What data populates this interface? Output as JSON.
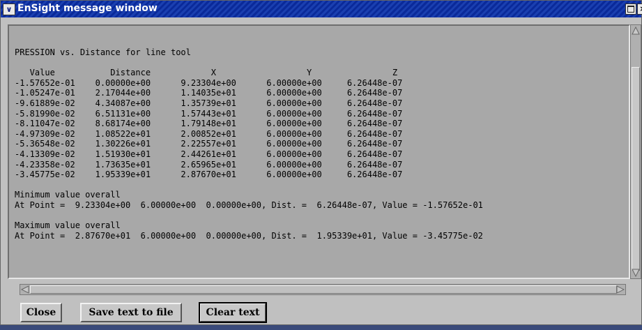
{
  "window": {
    "title": "EnSight message window",
    "menu_icon": "chevron-down-icon",
    "maximize_icon": "maximize-icon",
    "close_icon": "close-icon",
    "close_glyph": "×"
  },
  "message": {
    "heading": "PRESSION vs. Distance for line tool",
    "columns": [
      "Value",
      "Distance",
      "X",
      "Y",
      "Z"
    ],
    "rows": [
      [
        "-1.57652e-01",
        "0.00000e+00",
        "9.23304e+00",
        "6.00000e+00",
        "6.26448e-07"
      ],
      [
        "-1.05247e-01",
        "2.17044e+00",
        "1.14035e+01",
        "6.00000e+00",
        "6.26448e-07"
      ],
      [
        "-9.61889e-02",
        "4.34087e+00",
        "1.35739e+01",
        "6.00000e+00",
        "6.26448e-07"
      ],
      [
        "-5.81990e-02",
        "6.51131e+00",
        "1.57443e+01",
        "6.00000e+00",
        "6.26448e-07"
      ],
      [
        "-8.11047e-02",
        "8.68174e+00",
        "1.79148e+01",
        "6.00000e+00",
        "6.26448e-07"
      ],
      [
        "-4.97309e-02",
        "1.08522e+01",
        "2.00852e+01",
        "6.00000e+00",
        "6.26448e-07"
      ],
      [
        "-5.36548e-02",
        "1.30226e+01",
        "2.22557e+01",
        "6.00000e+00",
        "6.26448e-07"
      ],
      [
        "-4.13309e-02",
        "1.51930e+01",
        "2.44261e+01",
        "6.00000e+00",
        "6.26448e-07"
      ],
      [
        "-4.23358e-02",
        "1.73635e+01",
        "2.65965e+01",
        "6.00000e+00",
        "6.26448e-07"
      ],
      [
        "-3.45775e-02",
        "1.95339e+01",
        "2.87670e+01",
        "6.00000e+00",
        "6.26448e-07"
      ]
    ],
    "min_label": "Minimum value overall",
    "min_line": "At Point =  9.23304e+00  6.00000e+00  0.00000e+00, Dist. =  6.26448e-07, Value = -1.57652e-01",
    "max_label": "Maximum value overall",
    "max_line": "At Point =  2.87670e+01  6.00000e+00  0.00000e+00, Dist. =  1.95339e+01, Value = -3.45775e-02"
  },
  "buttons": {
    "close": "Close",
    "save": "Save text to file",
    "clear": "Clear text"
  },
  "colors": {
    "titlebar": "#1a3fb0",
    "panel": "#c0c0c0",
    "text_area": "#a8a8a8"
  }
}
